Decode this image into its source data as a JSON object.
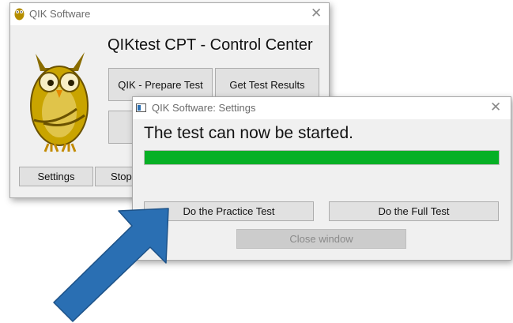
{
  "main_window": {
    "title": "QIK Software",
    "close_glyph": "✕",
    "heading": "QIKtest CPT - Control Center",
    "buttons": {
      "prepare_test": "QIK - Prepare Test",
      "get_results": "Get Test Results",
      "settings": "Settings",
      "stop": "Stop"
    },
    "logo_icon": "owl-mascot-icon"
  },
  "settings_dialog": {
    "title": "QIK Software: Settings",
    "close_glyph": "✕",
    "message": "The test can now be started.",
    "progress_fraction": 1.0,
    "buttons": {
      "practice": "Do the Practice Test",
      "full": "Do the Full Test",
      "close": "Close window"
    }
  },
  "annotation": {
    "arrow_icon": "pointer-arrow-icon",
    "arrow_color": "#2a6fb3"
  },
  "colors": {
    "progress_green": "#06b025",
    "owl_gold": "#c9a400"
  }
}
